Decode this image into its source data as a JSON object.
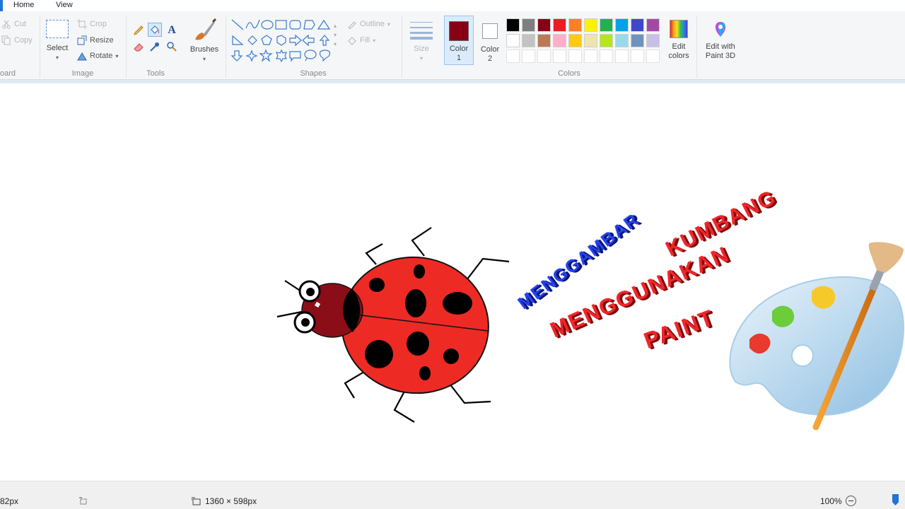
{
  "tabs": {
    "home": "Home",
    "view": "View"
  },
  "clipboard": {
    "cut": "Cut",
    "copy": "Copy",
    "group": "oard"
  },
  "image": {
    "select": "Select",
    "crop": "Crop",
    "resize": "Resize",
    "rotate": "Rotate",
    "group": "Image"
  },
  "tools": {
    "group": "Tools",
    "brushes": "Brushes"
  },
  "shapes": {
    "group": "Shapes",
    "outline": "Outline",
    "fill": "Fill"
  },
  "size": {
    "label": "Size"
  },
  "colors": {
    "group": "Colors",
    "color1_label": "Color 1",
    "color1_l1": "Color",
    "color1_l2": "1",
    "color2_l1": "Color",
    "color2_l2": "2",
    "color1_value": "#880015",
    "color2_value": "#ffffff",
    "edit_l1": "Edit",
    "edit_l2": "colors",
    "paint3d_l1": "Edit with",
    "paint3d_l2": "Paint 3D",
    "swatches_row1": [
      "#000000",
      "#7f7f7f",
      "#880015",
      "#ed1c24",
      "#ff7f27",
      "#fff200",
      "#22b14c",
      "#00a2e8",
      "#3f48cc",
      "#a349a4"
    ],
    "swatches_row2": [
      "#ffffff",
      "#c3c3c3",
      "#b97a57",
      "#ffaec9",
      "#ffc90e",
      "#efe4b0",
      "#b5e61d",
      "#99d9ea",
      "#7092be",
      "#c8bfe7"
    ]
  },
  "artwork": {
    "line1": "MENGGAMBAR",
    "line2": "KUMBANG",
    "line3": "MENGGUNAKAN",
    "line4": "PAINT"
  },
  "status": {
    "cursor": "82px",
    "dimensions": "1360 × 598px",
    "zoom": "100%"
  }
}
